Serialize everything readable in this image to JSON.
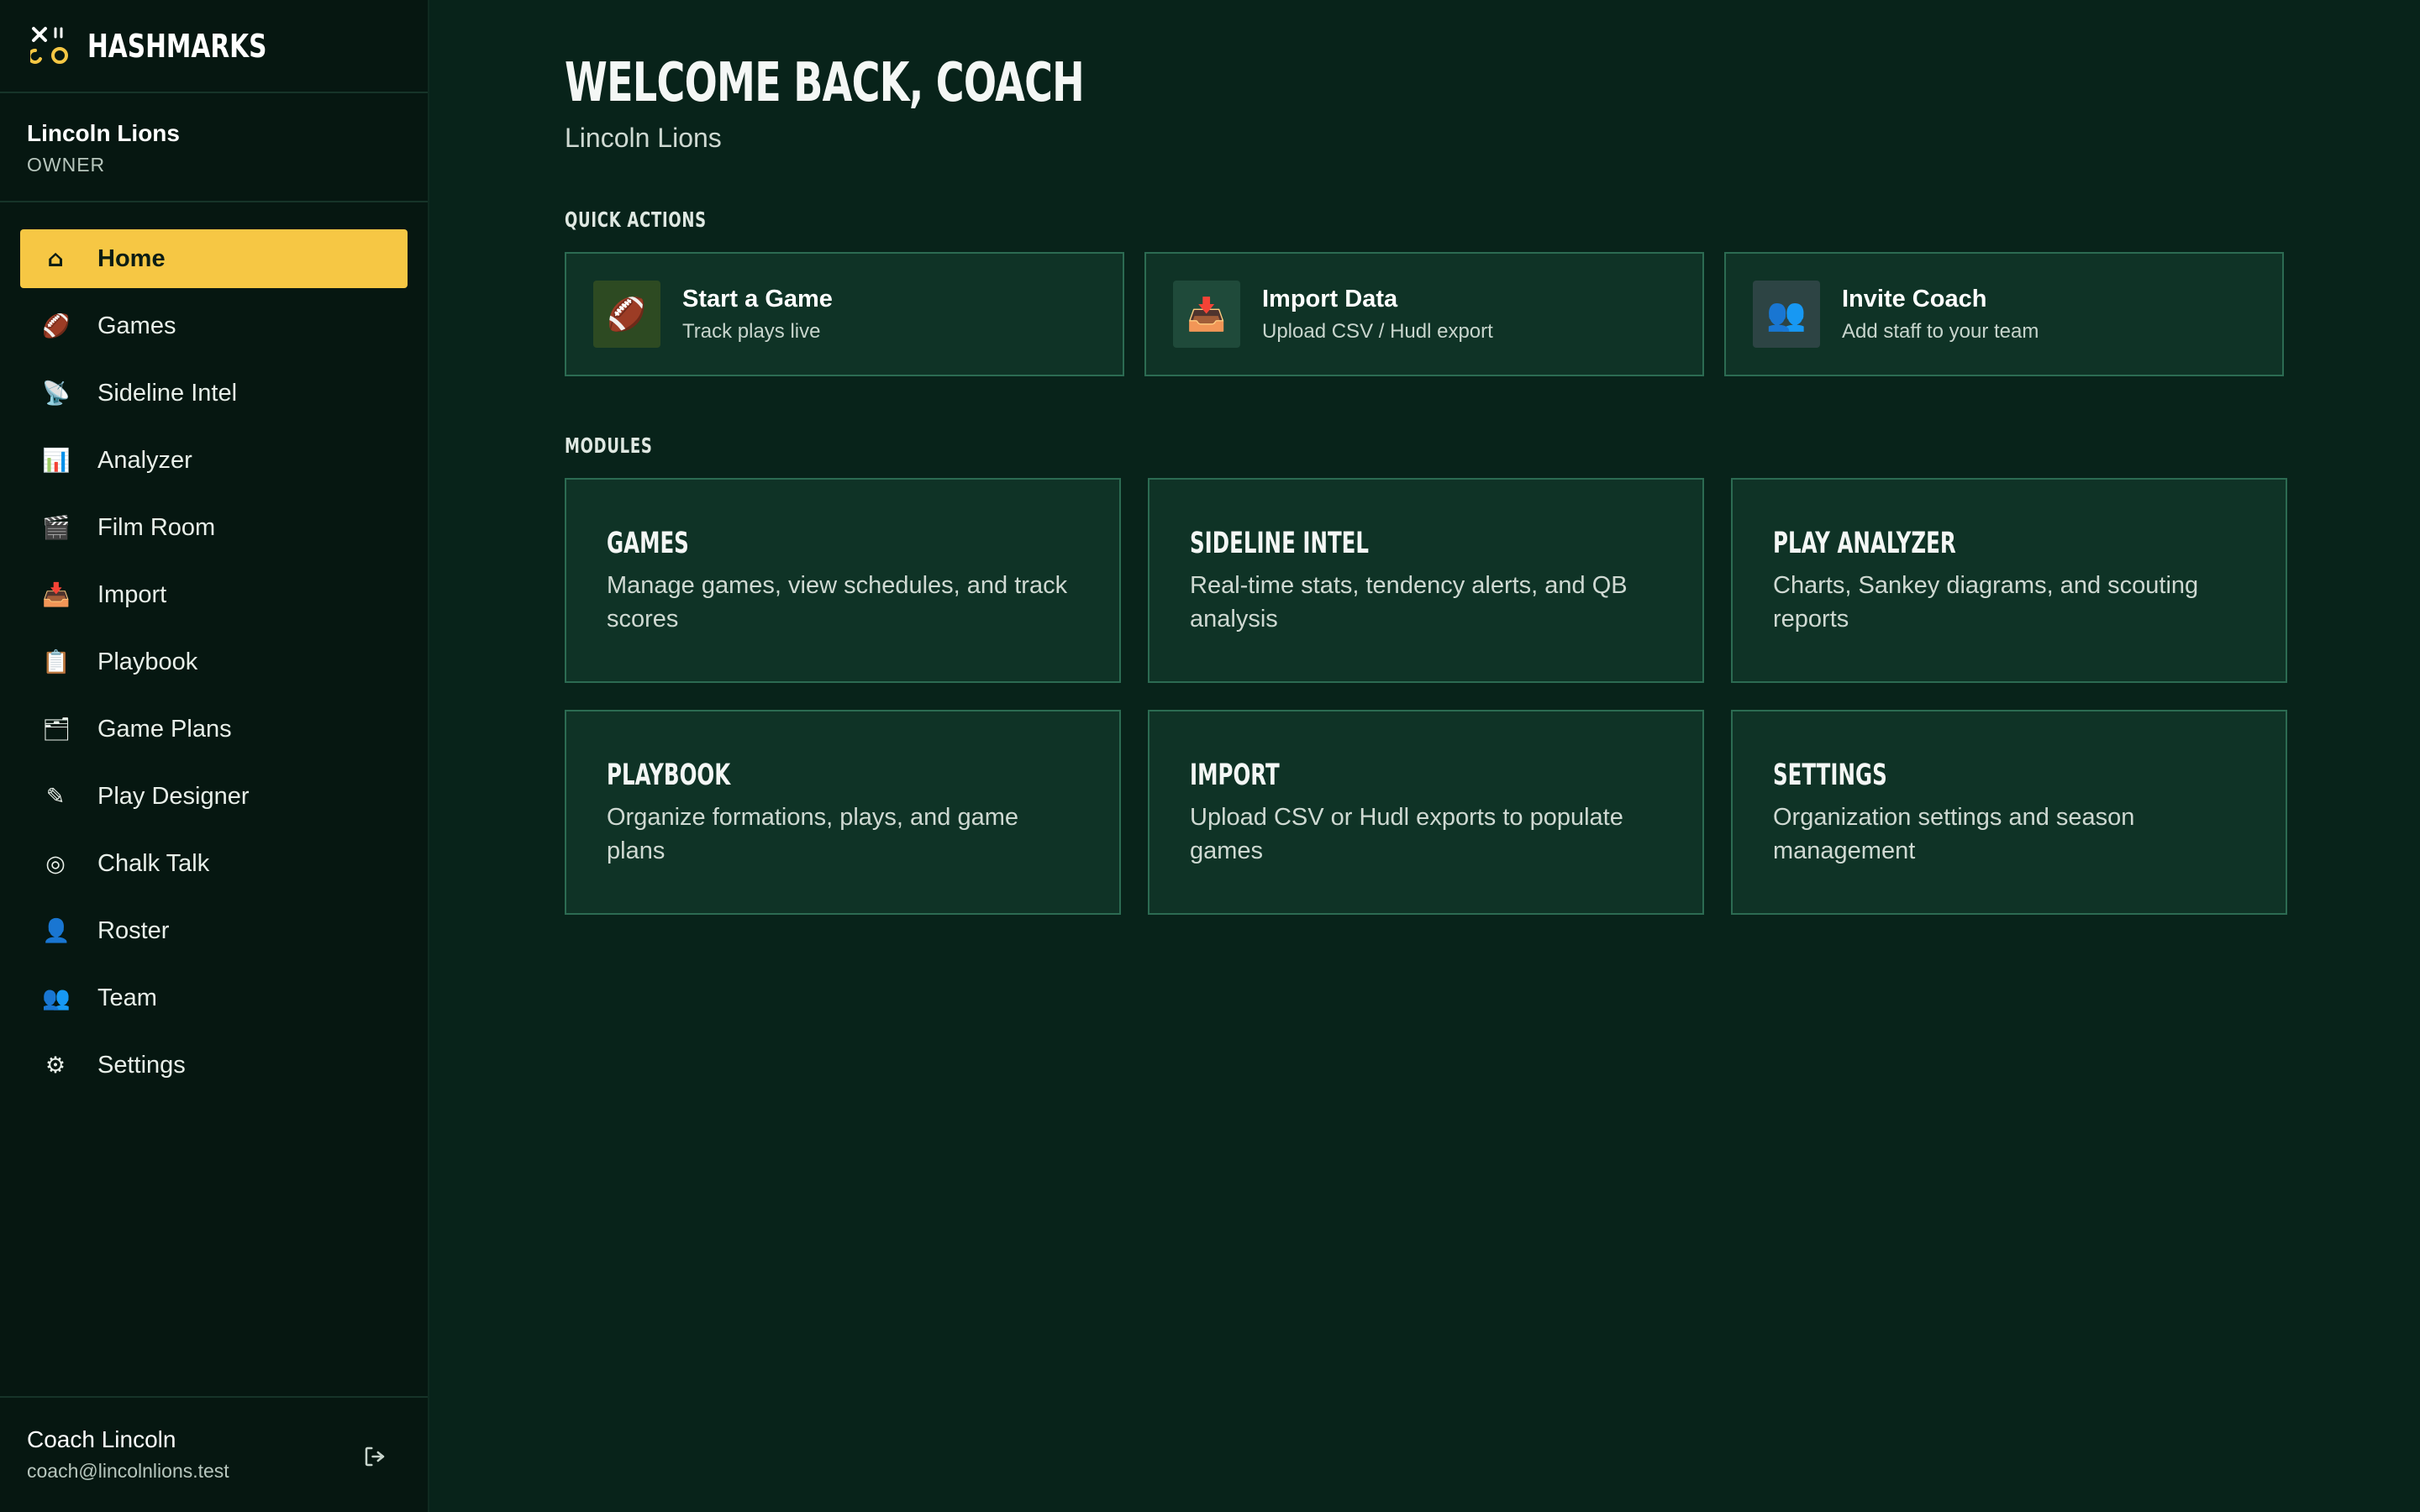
{
  "brand": {
    "name": "HASHMARKS"
  },
  "org": {
    "name": "Lincoln Lions",
    "role": "OWNER"
  },
  "nav": [
    {
      "icon": "home-icon",
      "glyph": "⌂",
      "label": "Home",
      "active": true
    },
    {
      "icon": "football-icon",
      "glyph": "🏈",
      "label": "Games"
    },
    {
      "icon": "satellite-icon",
      "glyph": "📡",
      "label": "Sideline Intel"
    },
    {
      "icon": "bar-chart-icon",
      "glyph": "📊",
      "label": "Analyzer"
    },
    {
      "icon": "clapperboard-icon",
      "glyph": "🎬",
      "label": "Film Room"
    },
    {
      "icon": "inbox-tray-icon",
      "glyph": "📥",
      "label": "Import"
    },
    {
      "icon": "clipboard-icon",
      "glyph": "📋",
      "label": "Playbook"
    },
    {
      "icon": "card-index-icon",
      "glyph": "🗂",
      "label": "Game Plans"
    },
    {
      "icon": "pencil-icon",
      "glyph": "✎",
      "label": "Play Designer"
    },
    {
      "icon": "target-icon",
      "glyph": "◎",
      "label": "Chalk Talk"
    },
    {
      "icon": "person-icon",
      "glyph": "👤",
      "label": "Roster"
    },
    {
      "icon": "people-icon",
      "glyph": "👥",
      "label": "Team"
    },
    {
      "icon": "gear-icon",
      "glyph": "⚙",
      "label": "Settings"
    }
  ],
  "user": {
    "name": "Coach Lincoln",
    "email": "coach@lincolnlions.test"
  },
  "main": {
    "title": "WELCOME BACK, COACH",
    "subtitle": "Lincoln Lions",
    "quick_actions_label": "QUICK ACTIONS",
    "modules_label": "MODULES"
  },
  "quick_actions": [
    {
      "icon": "football-icon",
      "glyph": "🏈",
      "icon_bg": "#2d4a22",
      "title": "Start a Game",
      "sub": "Track plays live"
    },
    {
      "icon": "inbox-tray-icon",
      "glyph": "📥",
      "icon_bg": "#1f4a3a",
      "title": "Import Data",
      "sub": "Upload CSV / Hudl export"
    },
    {
      "icon": "people-icon",
      "glyph": "👥",
      "icon_bg": "#2d4444",
      "title": "Invite Coach",
      "sub": "Add staff to your team"
    }
  ],
  "modules": [
    {
      "title": "GAMES",
      "desc": "Manage games, view schedules, and track scores"
    },
    {
      "title": "SIDELINE INTEL",
      "desc": "Real-time stats, tendency alerts, and QB analysis"
    },
    {
      "title": "PLAY ANALYZER",
      "desc": "Charts, Sankey diagrams, and scouting reports"
    },
    {
      "title": "PLAYBOOK",
      "desc": "Organize formations, plays, and game plans"
    },
    {
      "title": "IMPORT",
      "desc": "Upload CSV or Hudl exports to populate games"
    },
    {
      "title": "SETTINGS",
      "desc": "Organization settings and season management"
    }
  ],
  "colors": {
    "accent": "#f6c744",
    "background": "#08231a",
    "sidebar": "#061711",
    "card": "#0f3326",
    "card_border": "#2c6b52"
  }
}
